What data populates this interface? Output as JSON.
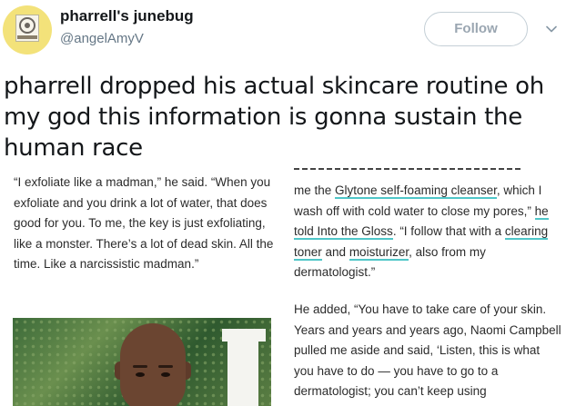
{
  "header": {
    "display_name": "pharrell's junebug",
    "handle": "@angelAmyV",
    "follow_label": "Follow",
    "menu_icon": "chevron-down-icon"
  },
  "tweet": {
    "text": "pharrell dropped his actual skincare routine oh my god this information is gonna sustain the human race"
  },
  "article": {
    "left_quote": "“I exfoliate like a madman,” he said. “When you exfoliate and you drink a lot of water, that does good for you. To me, the key is just exfoliating, like a monster. There’s a lot of dead skin. All the time. Like a narcissistic madman.”",
    "right_p1_prefix": "me the ",
    "right_link_1": "Glytone self-foaming cleanser",
    "right_p1_mid": ", which I wash off with cold water to close my pores,” ",
    "right_link_2": "he told Into the Gloss",
    "right_p1_mid2": ". “I follow that with a ",
    "right_link_3": "clearing toner",
    "right_p1_mid3": " and ",
    "right_link_4": "moisturizer",
    "right_p1_suffix": ", also from my dermatologist.”",
    "right_p2": "He added, “You have to take care of your skin. Years and years and years ago, Naomi Campbell pulled me aside and said, ‘Listen, this is what you have to do — you have to go to a dermatologist; you can’t keep using",
    "accent_color": "#4fc6c8"
  }
}
